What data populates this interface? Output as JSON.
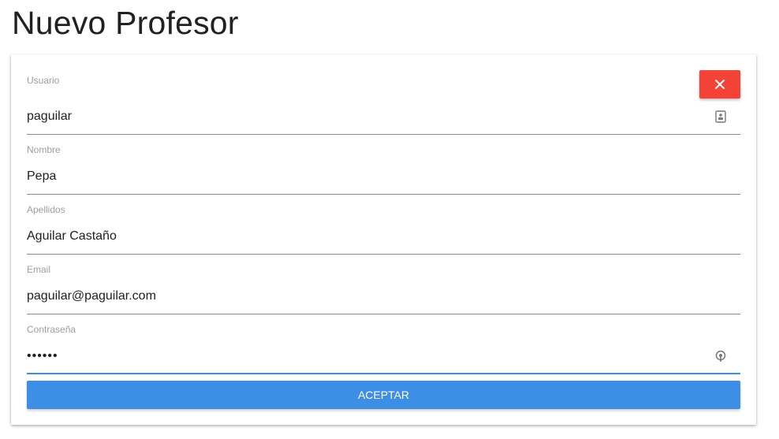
{
  "page": {
    "title": "Nuevo Profesor"
  },
  "form": {
    "close_icon": "close-icon",
    "fields": {
      "usuario": {
        "label": "Usuario",
        "value": "paguilar",
        "icon": "contact-card-icon"
      },
      "nombre": {
        "label": "Nombre",
        "value": "Pepa"
      },
      "apellidos": {
        "label": "Apellidos",
        "value": "Aguilar Castaño"
      },
      "email": {
        "label": "Email",
        "value": "paguilar@paguilar.com"
      },
      "password": {
        "label": "Contraseña",
        "value": "••••••",
        "icon": "key-icon"
      }
    },
    "accept_label": "ACEPTAR"
  },
  "colors": {
    "close_button": "#f44336",
    "accept_button": "#3d8fe6",
    "active_underline": "#3d8fe6"
  }
}
